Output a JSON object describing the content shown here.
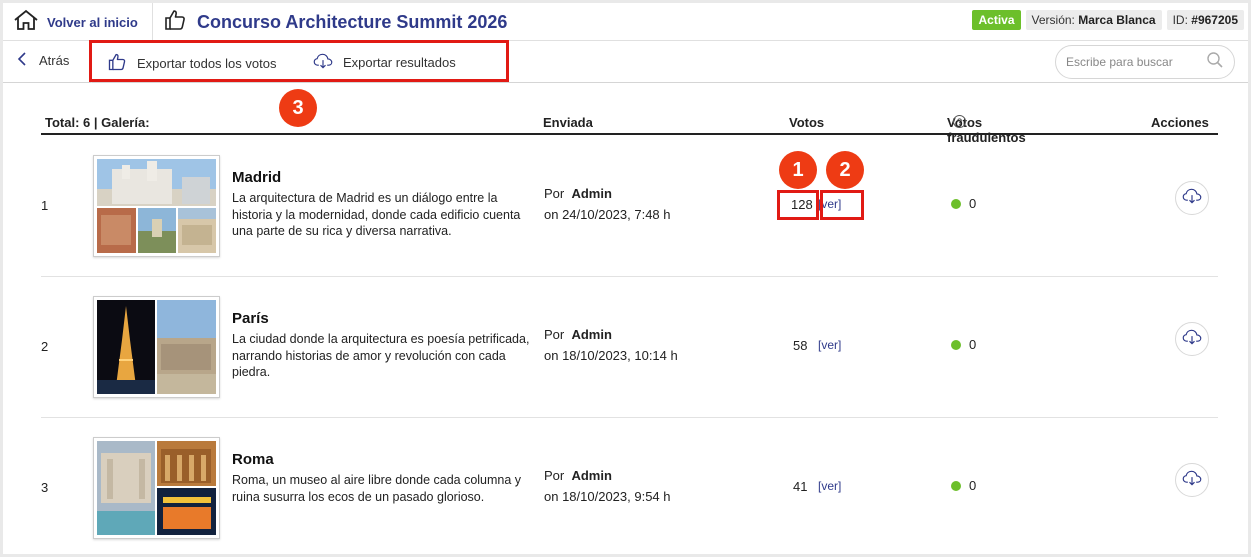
{
  "header": {
    "home_label": "Volver al inicio",
    "title": "Concurso Architecture Summit 2026",
    "status": "Activa",
    "version_label": "Versión:",
    "version_value": "Marca Blanca",
    "id_label": "ID:",
    "id_value": "#967205"
  },
  "toolbar": {
    "back_label": "Atrás",
    "export_votes_label": "Exportar todos los votos",
    "export_results_label": "Exportar resultados",
    "search_placeholder": "Escribe para buscar"
  },
  "callouts": [
    "1",
    "2",
    "3"
  ],
  "table": {
    "total_label": "Total: 6 | Galería:",
    "columns": {
      "sent": "Enviada",
      "votes": "Votos",
      "fraud": "Votos fraudulentos",
      "actions": "Acciones"
    },
    "rows": [
      {
        "index": "1",
        "title": "Madrid",
        "description": "La arquitectura de Madrid es un diálogo entre la historia y la modernidad, donde cada edificio cuenta una parte de su rica y diversa narrativa.",
        "by_label": "Por",
        "by_user": "Admin",
        "sent_on": "on 24/10/2023, 7:48 h",
        "votes": "128",
        "ver_label": "[ver]",
        "fraud": "0"
      },
      {
        "index": "2",
        "title": "París",
        "description": "La ciudad donde la arquitectura es poesía petrificada, narrando historias de amor y revolución con cada piedra.",
        "by_label": "Por",
        "by_user": "Admin",
        "sent_on": "on 18/10/2023, 10:14 h",
        "votes": "58",
        "ver_label": "[ver]",
        "fraud": "0"
      },
      {
        "index": "3",
        "title": "Roma",
        "description": "Roma, un museo al aire libre donde cada columna y ruina susurra los ecos de un pasado glorioso.",
        "by_label": "Por",
        "by_user": "Admin",
        "sent_on": "on 18/10/2023, 9:54 h",
        "votes": "41",
        "ver_label": "[ver]",
        "fraud": "0"
      }
    ]
  },
  "colors": {
    "brand": "#2f3a8a",
    "active": "#6cbf2a",
    "highlight": "#e11a14",
    "callout": "#ee3b14"
  }
}
